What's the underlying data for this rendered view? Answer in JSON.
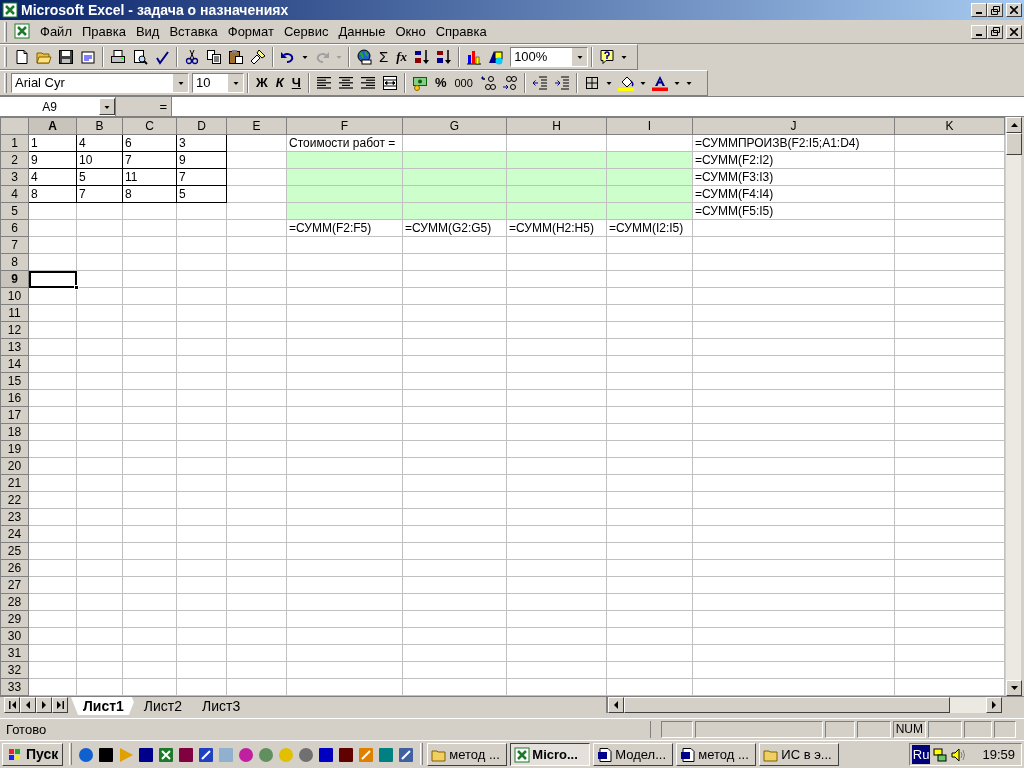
{
  "window": {
    "title": "Microsoft Excel - задача о назначениях"
  },
  "menu": [
    "Файл",
    "Правка",
    "Вид",
    "Вставка",
    "Формат",
    "Сервис",
    "Данные",
    "Окно",
    "Справка"
  ],
  "standard_toolbar": {
    "sum_button": "Σ",
    "function_button": "fx",
    "zoom": "100%"
  },
  "formatting_toolbar": {
    "font": "Arial Cyr",
    "size": "10",
    "bold_button": "Ж",
    "italic_button": "К",
    "underline_button": "Ч",
    "percent_button": "%",
    "thousands_button": "000"
  },
  "formula_bar": {
    "name_box": "A9",
    "equals_button": "="
  },
  "sheet": {
    "columns": [
      "A",
      "B",
      "C",
      "D",
      "E",
      "F",
      "G",
      "H",
      "I",
      "J",
      "K"
    ],
    "rows": [
      {
        "header": "1",
        "cells": [
          {
            "text": "1",
            "bordered": true
          },
          {
            "text": "4",
            "bordered": true
          },
          {
            "text": "6",
            "bordered": true
          },
          {
            "text": "3",
            "bordered": true
          },
          null,
          {
            "text": "Стоимости работ ="
          },
          null,
          null,
          null,
          {
            "text": "=СУММПРОИЗВ(F2:I5;A1:D4)"
          },
          null
        ]
      },
      {
        "header": "2",
        "cells": [
          {
            "text": "9",
            "bordered": true
          },
          {
            "text": "10",
            "bordered": true
          },
          {
            "text": "7",
            "bordered": true
          },
          {
            "text": "9",
            "bordered": true
          },
          null,
          {
            "shaded": true
          },
          {
            "shaded": true
          },
          {
            "shaded": true
          },
          {
            "shaded": true
          },
          {
            "text": "=СУММ(F2:I2)"
          },
          null
        ]
      },
      {
        "header": "3",
        "cells": [
          {
            "text": "4",
            "bordered": true
          },
          {
            "text": "5",
            "bordered": true
          },
          {
            "text": "11",
            "bordered": true
          },
          {
            "text": "7",
            "bordered": true
          },
          null,
          {
            "shaded": true
          },
          {
            "shaded": true
          },
          {
            "shaded": true
          },
          {
            "shaded": true
          },
          {
            "text": "=СУММ(F3:I3)"
          },
          null
        ]
      },
      {
        "header": "4",
        "cells": [
          {
            "text": "8",
            "bordered": true
          },
          {
            "text": "7",
            "bordered": true
          },
          {
            "text": "8",
            "bordered": true
          },
          {
            "text": "5",
            "bordered": true
          },
          null,
          {
            "shaded": true
          },
          {
            "shaded": true
          },
          {
            "shaded": true
          },
          {
            "shaded": true
          },
          {
            "text": "=СУММ(F4:I4)"
          },
          null
        ]
      },
      {
        "header": "5",
        "cells": [
          null,
          null,
          null,
          null,
          null,
          {
            "shaded": true
          },
          {
            "shaded": true
          },
          {
            "shaded": true
          },
          {
            "shaded": true
          },
          {
            "text": "=СУММ(F5:I5)"
          },
          null
        ]
      },
      {
        "header": "6",
        "cells": [
          null,
          null,
          null,
          null,
          null,
          {
            "text": "=СУММ(F2:F5)"
          },
          {
            "text": "=СУММ(G2:G5)"
          },
          {
            "text": "=СУММ(H2:H5)"
          },
          {
            "text": "=СУММ(I2:I5)"
          },
          null,
          null
        ]
      },
      {
        "header": "7"
      },
      {
        "header": "8"
      },
      {
        "header": "9",
        "cells": [
          {
            "selected": true
          }
        ]
      },
      {
        "header": "10"
      },
      {
        "header": "11"
      },
      {
        "header": "12"
      },
      {
        "header": "13"
      },
      {
        "header": "14"
      },
      {
        "header": "15"
      },
      {
        "header": "16"
      },
      {
        "header": "17"
      },
      {
        "header": "18"
      },
      {
        "header": "19"
      },
      {
        "header": "20"
      },
      {
        "header": "21"
      },
      {
        "header": "22"
      },
      {
        "header": "23"
      },
      {
        "header": "24"
      },
      {
        "header": "25"
      },
      {
        "header": "26"
      },
      {
        "header": "27"
      },
      {
        "header": "28"
      },
      {
        "header": "29"
      },
      {
        "header": "30"
      },
      {
        "header": "31"
      },
      {
        "header": "32"
      },
      {
        "header": "33"
      }
    ]
  },
  "sheet_tabs": [
    {
      "label": "Лист1",
      "selected": true
    },
    {
      "label": "Лист2",
      "selected": false
    },
    {
      "label": "Лист3",
      "selected": false
    }
  ],
  "status_bar": {
    "message": "Готово",
    "num_indicator": "NUM"
  },
  "taskbar": {
    "start_button": "Пуск",
    "tasks": [
      {
        "label": "метод ...",
        "kind": "folder",
        "selected": false
      },
      {
        "label": "Micro...",
        "kind": "excel",
        "selected": true
      },
      {
        "label": "Модел...",
        "kind": "word",
        "selected": false
      },
      {
        "label": "метод ...",
        "kind": "word",
        "selected": false
      },
      {
        "label": "ИС в э...",
        "kind": "folder",
        "selected": false
      }
    ],
    "language": "Ru",
    "clock": "19:59"
  }
}
